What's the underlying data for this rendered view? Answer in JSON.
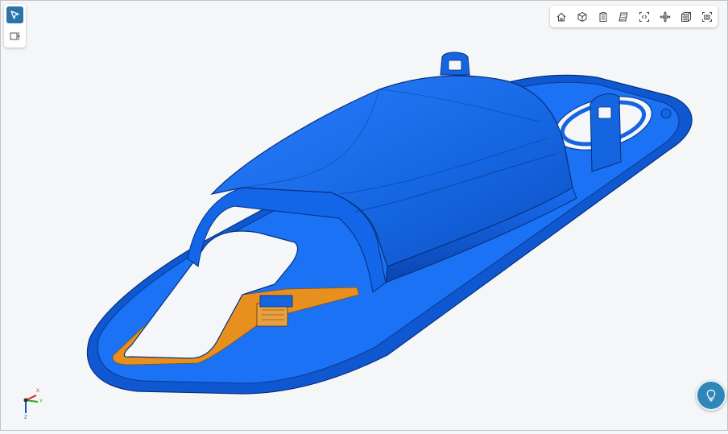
{
  "colors": {
    "part_blue": "#1565e0",
    "part_blue_dark": "#0a3f9e",
    "part_blue_light": "#2d86ff",
    "highlight_orange": "#e8901f",
    "toolbar_accent": "#2b74a8",
    "hint_button": "#2f86b8"
  },
  "left_toolbar": {
    "tools": [
      {
        "icon": "cursor-select-icon",
        "active": true
      },
      {
        "icon": "section-view-icon",
        "active": false
      }
    ]
  },
  "view_toolbar": {
    "buttons": [
      {
        "icon": "home-view-icon"
      },
      {
        "icon": "cube-view-icon"
      },
      {
        "icon": "clipboard-icon"
      },
      {
        "icon": "shaded-layers-icon"
      },
      {
        "icon": "fit-view-icon"
      },
      {
        "icon": "orbit-center-icon"
      },
      {
        "icon": "wireframe-cube-icon"
      },
      {
        "icon": "screenshot-icon"
      }
    ]
  },
  "axes": {
    "x": "X",
    "y": "Y",
    "z": "Z"
  },
  "hint_button": {
    "icon": "lightbulb-icon"
  }
}
